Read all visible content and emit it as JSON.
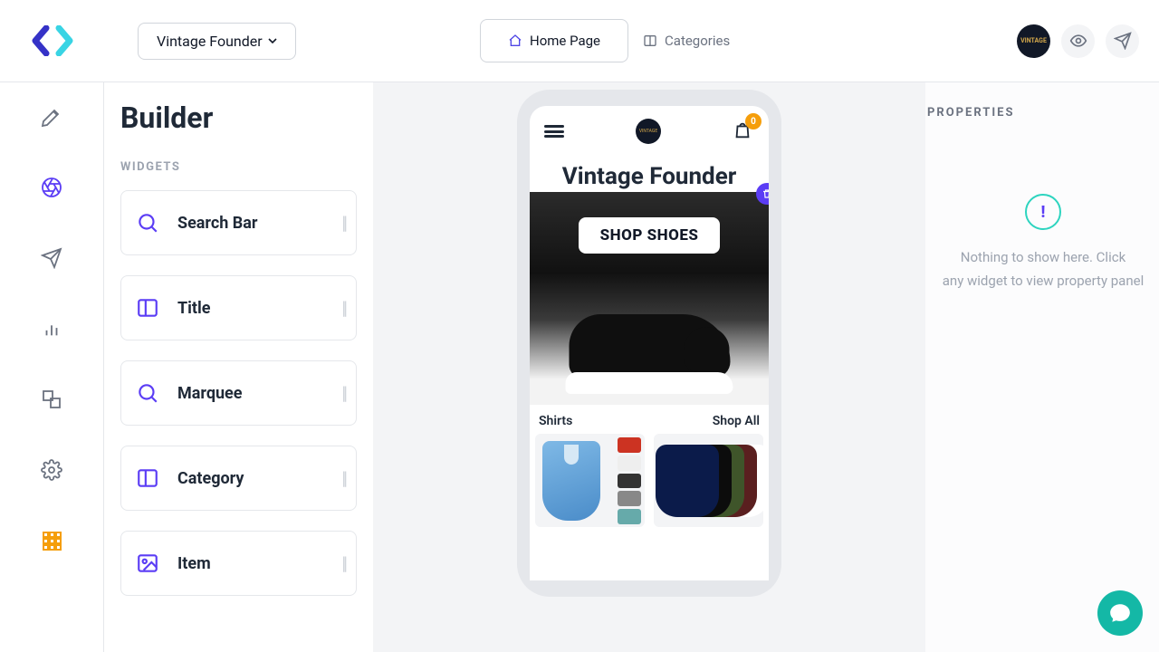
{
  "store_name": "Vintage Founder",
  "topnav": {
    "home": "Home Page",
    "categories": "Categories"
  },
  "builder": {
    "title": "Builder",
    "widgets_label": "WIDGETS",
    "widgets": [
      {
        "label": "Search Bar",
        "icon": "search-icon"
      },
      {
        "label": "Title",
        "icon": "layout-icon"
      },
      {
        "label": "Marquee",
        "icon": "search-icon"
      },
      {
        "label": "Category",
        "icon": "layout-icon"
      },
      {
        "label": "Item",
        "icon": "image-icon"
      }
    ]
  },
  "preview": {
    "store_title": "Vintage Founder",
    "cart_count": "0",
    "hero_cta": "SHOP SHOES",
    "section": {
      "title": "Shirts",
      "link": "Shop All"
    }
  },
  "properties": {
    "heading": "PROPERTIES",
    "empty_line1": "Nothing to show here. Click",
    "empty_line2": "any widget to view property panel"
  },
  "colors": {
    "accent": "#5b3df5",
    "teal": "#14b8a6",
    "amber": "#f59e0b"
  }
}
